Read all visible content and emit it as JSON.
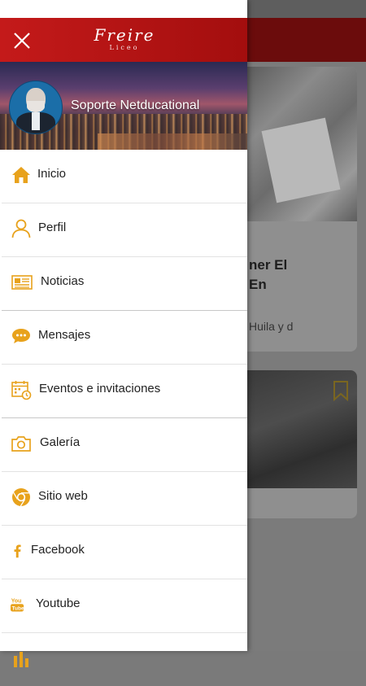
{
  "background_app": {
    "card1": {
      "title_line1": "ner El",
      "title_line2": "En",
      "snippet": "Huila y d"
    }
  },
  "drawer": {
    "logo_main": "Freire",
    "logo_sub": "Liceo",
    "profile": {
      "name": "Soporte Netducational"
    },
    "menu": [
      {
        "label": "Inicio",
        "icon": "home-icon"
      },
      {
        "label": "Perfil",
        "icon": "user-icon"
      },
      {
        "label": "Noticias",
        "icon": "newspaper-icon"
      },
      {
        "label": "Mensajes",
        "icon": "chat-bubble-icon"
      },
      {
        "label": "Eventos e invitaciones",
        "icon": "calendar-icon"
      },
      {
        "label": "Galería",
        "icon": "camera-icon"
      },
      {
        "label": "Sitio web",
        "icon": "chrome-icon"
      },
      {
        "label": "Facebook",
        "icon": "facebook-icon"
      },
      {
        "label": "Youtube",
        "icon": "youtube-icon"
      },
      {
        "label": "",
        "icon": "chart-icon"
      }
    ]
  },
  "colors": {
    "header_red": "#c41a1a",
    "icon_orange": "#e8a21c",
    "text": "#222222"
  }
}
